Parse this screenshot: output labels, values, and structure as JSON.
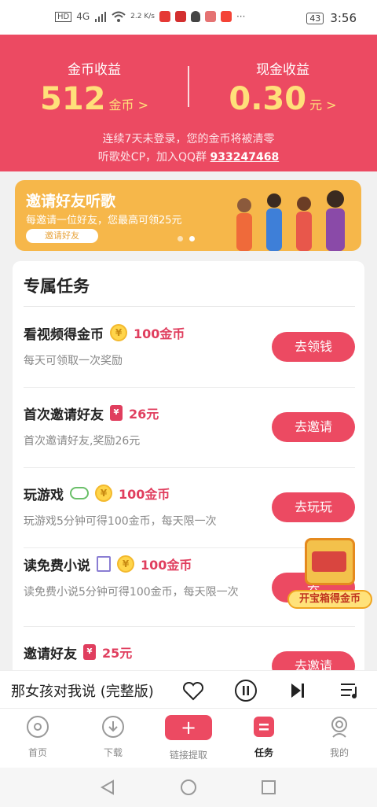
{
  "status_bar": {
    "network": "4G",
    "speed": "2.2 K/s",
    "battery": "43",
    "time": "3:56"
  },
  "earnings": {
    "coin_label": "金币收益",
    "coin_value": "512",
    "coin_unit": "金币 >",
    "cash_label": "现金收益",
    "cash_value": "0.30",
    "cash_unit": "元 >",
    "notice_line1": "连续7天未登录，您的金币将被清零",
    "notice_line2_prefix": "听歌处CP，加入QQ群",
    "qq_group": "933247468"
  },
  "banner": {
    "title": "邀请好友听歌",
    "subtitle": "每邀请一位好友，您最高可领25元",
    "button": "邀请好友"
  },
  "tasks": {
    "header": "专属任务",
    "items": [
      {
        "name": "看视频得金币",
        "reward": "100金币",
        "desc": "每天可领取一次奖励",
        "action": "去领钱",
        "icon": "coin-icon"
      },
      {
        "name": "首次邀请好友",
        "reward": "26元",
        "desc": "首次邀请好友,奖励26元",
        "action": "去邀请",
        "icon": "red-packet-icon"
      },
      {
        "name": "玩游戏",
        "reward": "100金币",
        "desc": "玩游戏5分钟可得100金币，每天限一次",
        "action": "去玩玩",
        "icon": "coin-icon"
      },
      {
        "name": "读免费小说",
        "reward": "100金币",
        "desc": "读免费小说5分钟可得100金币，每天限一次",
        "action": "去",
        "icon": "coin-icon"
      },
      {
        "name": "邀请好友",
        "reward": "25元",
        "desc": "",
        "action": "去邀请",
        "icon": "red-packet-icon"
      }
    ]
  },
  "treasure": {
    "label": "开宝箱得金币"
  },
  "player": {
    "song": "那女孩对我说 (完整版)"
  },
  "tabs": [
    {
      "label": "首页"
    },
    {
      "label": "下载"
    },
    {
      "label": "链接提取"
    },
    {
      "label": "任务"
    },
    {
      "label": "我的"
    }
  ],
  "colors": {
    "accent": "#ec4a62",
    "coin_gold": "#ffe07a",
    "banner": "#f6b74a"
  }
}
